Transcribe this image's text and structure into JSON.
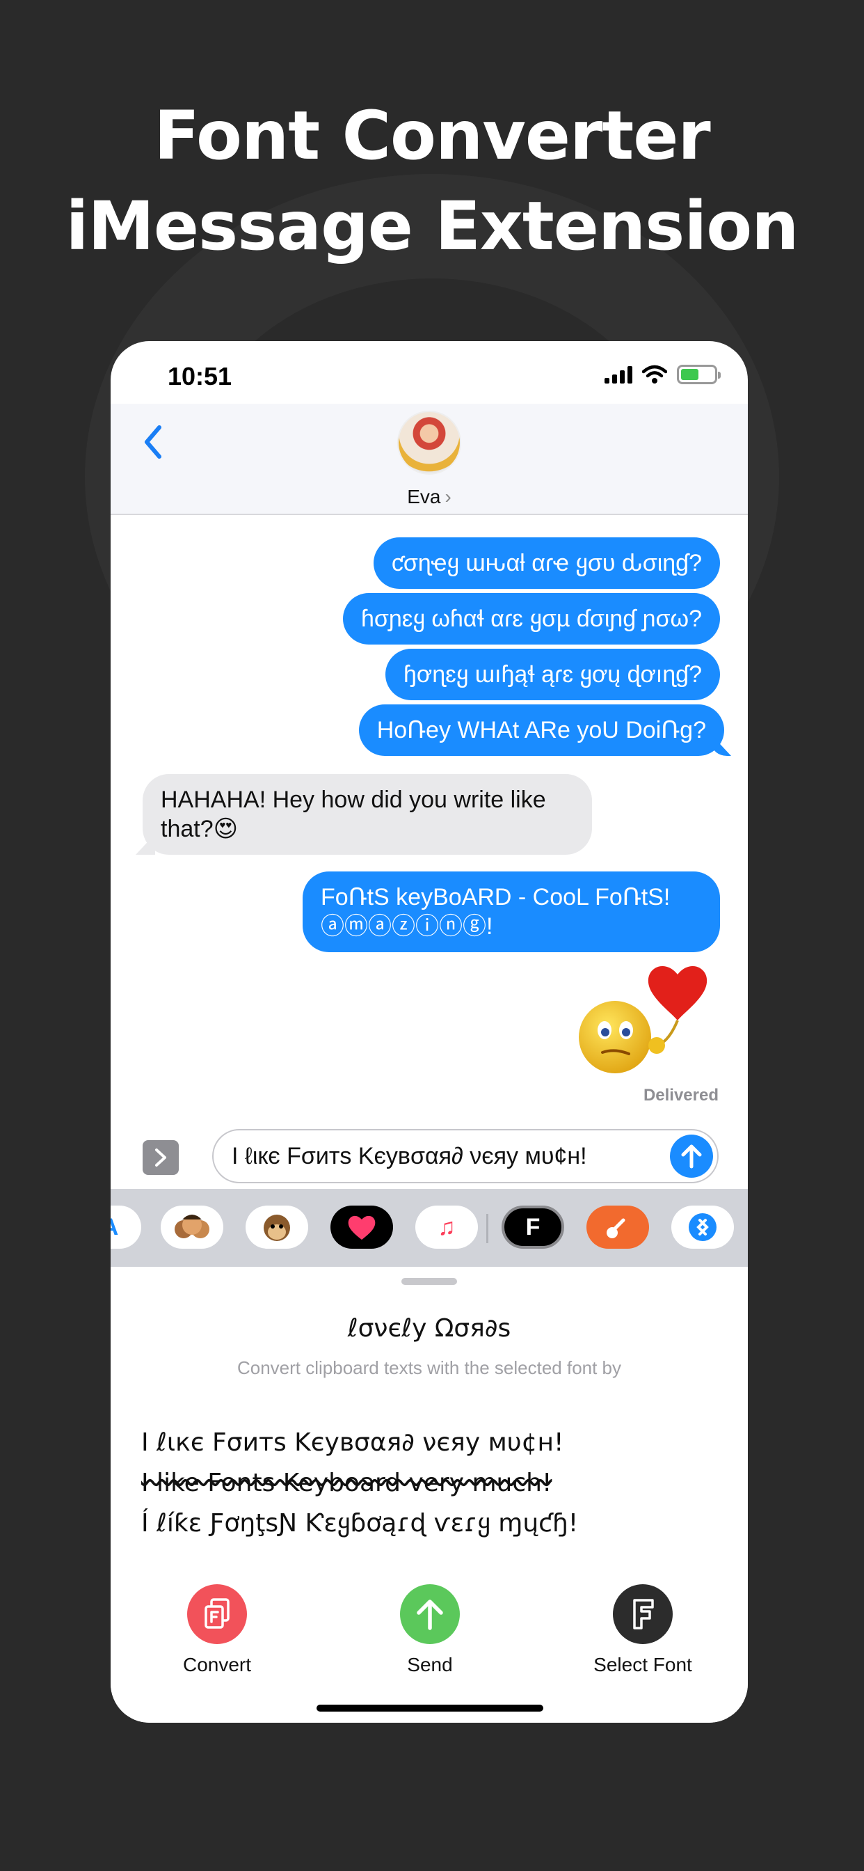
{
  "headline": [
    "Font Converter",
    "iMessage Extension"
  ],
  "status": {
    "time": "10:51"
  },
  "contact": {
    "name": "Eva",
    "chevron": "›"
  },
  "messages": [
    {
      "side": "sent",
      "text": "ƈσɳҽყ ɯԋαƚ αɾҽ ყσυ ԃσιɳɠ?"
    },
    {
      "side": "sent",
      "text": "ɦσɲɛყ ωɦαɬ αɾɛ ყσµ ɗσιɲɠ ɲσω?"
    },
    {
      "side": "sent",
      "text": "ɧơɳɛყ ɯıɧąɬ ąɾɛ ყơų ɖơıɳɠ?"
    },
    {
      "side": "sent",
      "text": "HoՌey WHAt ARe yoU DoiՌg?"
    },
    {
      "side": "recv",
      "text": "HAHAHA! Hey how did you write like that?😍"
    },
    {
      "side": "sent",
      "text": "FoՌtS keyBoARD - CooL FoՌtS! ⓐⓜⓐⓩⓘⓝⓖ!"
    }
  ],
  "delivered": "Delivered",
  "input": {
    "value": "I ℓιкє Fσитѕ Kєувσαя∂ νєяу мυ¢н!"
  },
  "sheet": {
    "title": "ℓσνєℓу Ωσя∂ѕ",
    "subtitle": "Convert clipboard texts with the selected font by",
    "samples": [
      "I ℓιкє Fσитѕ Kєувσαя∂ νєяу мυ¢н!",
      "I like Fonts Keyboard very much!",
      "Í ℓíƙɛ ƑơŋţѕƝ Ƙɛყɓơąɾɖ ѵɛɾყ ɱųƈɧ!"
    ],
    "actions": [
      {
        "label": "Convert",
        "color": "#f2525a",
        "icon": "convert-icon"
      },
      {
        "label": "Send",
        "color": "#5bc85b",
        "icon": "arrow-up-icon"
      },
      {
        "label": "Select Font",
        "color": "#2c2c2c",
        "icon": "font-f-icon"
      }
    ]
  },
  "app_strip": [
    "app-store",
    "memoji",
    "monkey",
    "digital-touch",
    "music",
    "fonts-app",
    "garageband",
    "shazam"
  ]
}
